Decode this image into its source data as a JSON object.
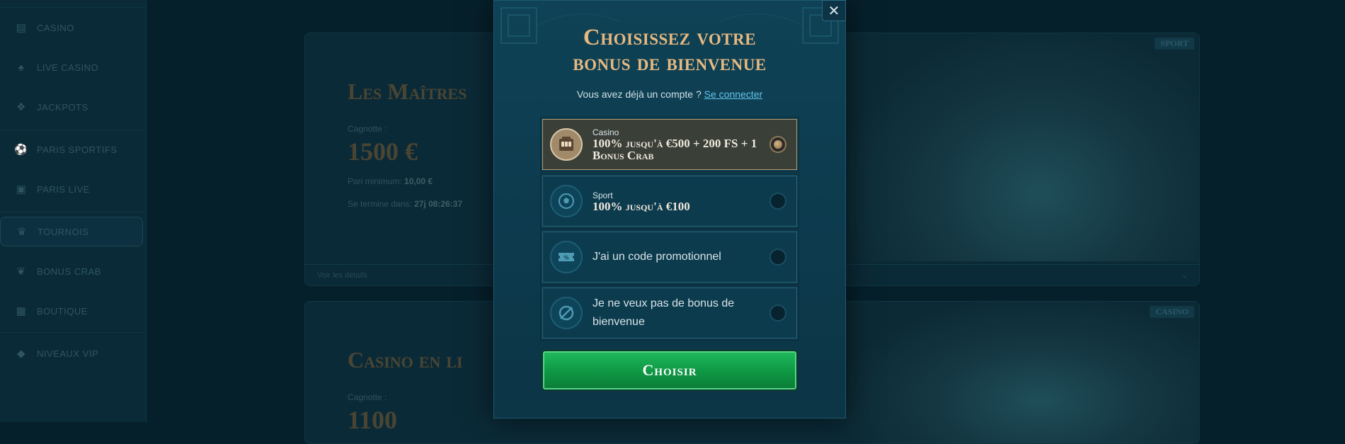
{
  "sidebar": {
    "items": [
      {
        "label": "CASINO",
        "icon": "slot-machine-icon"
      },
      {
        "label": "LIVE CASINO",
        "icon": "live-casino-icon"
      },
      {
        "label": "JACKPOTS",
        "icon": "jackpot-icon"
      },
      {
        "label": "PARIS SPORTIFS",
        "icon": "soccer-ball-icon"
      },
      {
        "label": "PARIS LIVE",
        "icon": "live-tv-icon"
      },
      {
        "label": "TOURNOIS",
        "icon": "trophy-icon",
        "active": true
      },
      {
        "label": "BONUS CRAB",
        "icon": "crab-claw-icon"
      },
      {
        "label": "BOUTIQUE",
        "icon": "shop-icon"
      },
      {
        "label": "NIVEAUX VIP",
        "icon": "diamond-icon"
      }
    ]
  },
  "tournaments": [
    {
      "title": "Les Maîtres",
      "pot_label": "Cagnotte :",
      "pot_value": "1500 €",
      "min_bet_label": "Pari minimum:",
      "min_bet_value": "10,00 €",
      "ends_label": "Se termine dans:",
      "ends_value": "27j 08:26:37",
      "details_link": "Voir les détails",
      "tag": "SPORT"
    },
    {
      "title": "Casino en li",
      "pot_label": "Cagnotte :",
      "pot_value": "1100",
      "tag": "CASINO"
    }
  ],
  "modal": {
    "title_line1": "Choisissez votre",
    "title_line2": "bonus de bienvenue",
    "login_prompt": "Vous avez déjà un compte ?",
    "login_link": "Se connecter",
    "options": [
      {
        "category": "Casino",
        "label": "100% jusqu'à €500 + 200 FS + 1 Bonus Crab",
        "icon": "slot-machine-icon",
        "selected": true
      },
      {
        "category": "Sport",
        "label": "100% jusqu'à €100",
        "icon": "soccer-ball-icon",
        "selected": false
      },
      {
        "category": "",
        "label": "J'ai un code promotionnel",
        "icon": "promo-ticket-icon",
        "selected": false
      },
      {
        "category": "",
        "label": "Je ne veux pas de bonus de bienvenue",
        "icon": "no-bonus-icon",
        "selected": false
      }
    ],
    "choose_button": "Choisir",
    "close_icon": "close-icon"
  },
  "colors": {
    "modal_bg": "#0f4256",
    "title_gold": "#e7b980",
    "link_blue": "#64c3ea",
    "button_green": "#0f9a45",
    "selected_option": "#3a3f38"
  }
}
